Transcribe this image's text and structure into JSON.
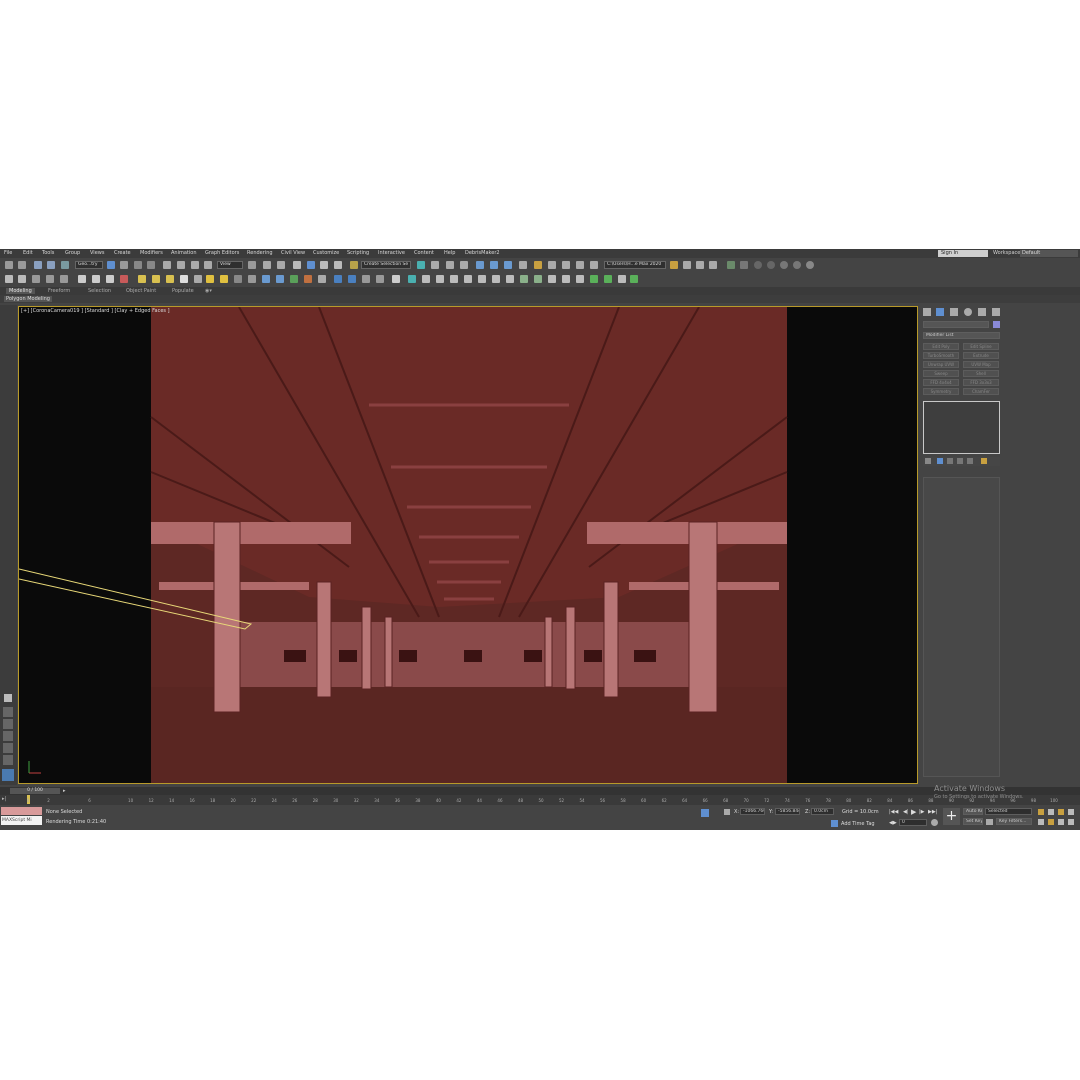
{
  "menu": [
    "File",
    "Edit",
    "Tools",
    "Group",
    "Views",
    "Create",
    "Modifiers",
    "Animation",
    "Graph Editors",
    "Rendering",
    "Civil View",
    "Customize",
    "Scripting",
    "Interactive",
    "Content",
    "Help",
    "DebrisMaker2"
  ],
  "account": {
    "sign_in": "Sign In",
    "workspaces_label": "Workspaces:",
    "workspace_value": "Default"
  },
  "toolbar": {
    "filter": "Geo...try",
    "ref_coord": "View",
    "selection_set": "Create Selection Se",
    "path": "C:\\Users\\H...e Max 2020"
  },
  "ribbon": {
    "tabs": [
      "Modeling",
      "Freeform",
      "Selection",
      "Object Paint",
      "Populate"
    ],
    "active_tab": "Modeling",
    "sub_label": "Polygon Modeling"
  },
  "viewport": {
    "label": "[+] [CoronaCamera019 ] [Standard ] [Clay + Edged Faces ]"
  },
  "command_panel": {
    "modifier_list": "Modifier List",
    "buttons": [
      "Edit Poly",
      "Edit Spline",
      "TurboSmooth",
      "Extrude",
      "Unwrap UVW",
      "UVW Map",
      "Sweep",
      "Shell",
      "FFD 4x4x4",
      "FFD 3x3x3",
      "Symmetry",
      "ChamFer"
    ]
  },
  "timeline": {
    "frame_range": "0 / 100",
    "ticks": [
      "0",
      "2",
      "6",
      "10",
      "12",
      "14",
      "16",
      "18",
      "20",
      "22",
      "24",
      "26",
      "28",
      "30",
      "32",
      "34",
      "36",
      "38",
      "40",
      "42",
      "44",
      "46",
      "48",
      "50",
      "52",
      "54",
      "56",
      "58",
      "60",
      "62",
      "64",
      "66",
      "68",
      "70",
      "72",
      "74",
      "76",
      "78",
      "80",
      "82",
      "84",
      "86",
      "88",
      "90",
      "92",
      "94",
      "96",
      "98",
      "100"
    ]
  },
  "status": {
    "script_box": "MAXScript Mi",
    "selection": "None Selected",
    "render_time": "Rendering Time  0:21:40",
    "x_label": "X:",
    "x_value": "-1066.766c",
    "y_label": "Y:",
    "y_value": "-5856.84c",
    "z_label": "Z:",
    "z_value": "0.0cm",
    "grid": "Grid = 10.0cm",
    "add_time_tag": "Add Time Tag",
    "auto_key": "Auto Key",
    "selected": "Selected",
    "set_key": "Set Key",
    "key_filters": "Key Filters...",
    "frame_value": "0"
  },
  "watermark": {
    "title": "Activate Windows",
    "subtitle": "Go to Settings to activate Windows."
  },
  "colors": {
    "viewport_bg": "#0a0a0a",
    "scene_fill": "#6a2a26",
    "highlight_border": "#b89a2a",
    "selection_wire": "#e8d878"
  }
}
